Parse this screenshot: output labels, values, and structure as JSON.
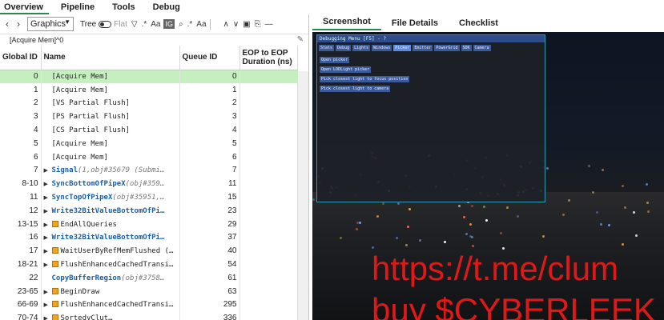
{
  "menu": [
    "Overview",
    "Pipeline",
    "Tools",
    "Debug"
  ],
  "toolbar": {
    "view_select": "Graphics",
    "tree_label": "Tree",
    "flat_label": "Flat",
    "aa_label": "Aa",
    "ig_label": "IG",
    "regex_label": ".*",
    "aa2_label": "Aa"
  },
  "breadcrumb": "[Acquire Mem]^0",
  "columns": [
    "Global ID",
    "Name",
    "Queue ID",
    "EOP to EOP Duration (ns)"
  ],
  "rows": [
    {
      "id": "0",
      "name": "[Acquire Mem]",
      "args": "",
      "queue": "0",
      "tri": false,
      "sq": false,
      "blue": false,
      "selected": true
    },
    {
      "id": "1",
      "name": "[Acquire Mem]",
      "args": "",
      "queue": "1",
      "tri": false,
      "sq": false,
      "blue": false,
      "selected": false
    },
    {
      "id": "2",
      "name": "[VS Partial Flush]",
      "args": "",
      "queue": "2",
      "tri": false,
      "sq": false,
      "blue": false,
      "selected": false
    },
    {
      "id": "3",
      "name": "[PS Partial Flush]",
      "args": "",
      "queue": "3",
      "tri": false,
      "sq": false,
      "blue": false,
      "selected": false
    },
    {
      "id": "4",
      "name": "[CS Partial Flush]",
      "args": "",
      "queue": "4",
      "tri": false,
      "sq": false,
      "blue": false,
      "selected": false
    },
    {
      "id": "5",
      "name": "[Acquire Mem]",
      "args": "",
      "queue": "5",
      "tri": false,
      "sq": false,
      "blue": false,
      "selected": false
    },
    {
      "id": "6",
      "name": "[Acquire Mem]",
      "args": "",
      "queue": "6",
      "tri": false,
      "sq": false,
      "blue": false,
      "selected": false
    },
    {
      "id": "7",
      "name": "Signal",
      "args": "(1,obj#35679 (Submi…",
      "queue": "7",
      "tri": true,
      "sq": false,
      "blue": true,
      "selected": false
    },
    {
      "id": "8-10",
      "name": "SyncBottomOfPipeX",
      "args": "(obj#359…",
      "queue": "11",
      "tri": true,
      "sq": false,
      "blue": true,
      "selected": false
    },
    {
      "id": "11",
      "name": "SyncTopOfPipeX",
      "args": "(obj#35951,…",
      "queue": "15",
      "tri": true,
      "sq": false,
      "blue": true,
      "selected": false
    },
    {
      "id": "12",
      "name": "Write32BitValueBottomOfPi…",
      "args": "",
      "queue": "23",
      "tri": true,
      "sq": false,
      "blue": true,
      "selected": false
    },
    {
      "id": "13-15",
      "name": "EndAllQueries",
      "args": "",
      "queue": "29",
      "tri": true,
      "sq": true,
      "blue": false,
      "selected": false
    },
    {
      "id": "16",
      "name": "Write32BitValueBottomOfPi…",
      "args": "",
      "queue": "37",
      "tri": true,
      "sq": false,
      "blue": true,
      "selected": false
    },
    {
      "id": "17",
      "name": "WaitUserByRefMemFlushed (…",
      "args": "",
      "queue": "40",
      "tri": true,
      "sq": true,
      "blue": false,
      "selected": false
    },
    {
      "id": "18-21",
      "name": "FlushEnhancedCachedTransi…",
      "args": "",
      "queue": "54",
      "tri": true,
      "sq": true,
      "blue": false,
      "selected": false
    },
    {
      "id": "22",
      "name": "CopyBufferRegion",
      "args": "(obj#3758…",
      "queue": "61",
      "tri": false,
      "sq": false,
      "blue": true,
      "selected": false
    },
    {
      "id": "23-65",
      "name": "BeginDraw",
      "args": "",
      "queue": "63",
      "tri": true,
      "sq": true,
      "blue": false,
      "selected": false
    },
    {
      "id": "66-69",
      "name": "FlushEnhancedCachedTransi…",
      "args": "",
      "queue": "295",
      "tri": true,
      "sq": true,
      "blue": false,
      "selected": false
    },
    {
      "id": "70-74",
      "name": "SortedyClut…",
      "args": "",
      "queue": "336",
      "tri": true,
      "sq": true,
      "blue": false,
      "selected": false
    }
  ],
  "right_tabs": [
    "Screenshot",
    "File Details",
    "Checklist"
  ],
  "screenshot": {
    "overlay_title": "Debugging Menu [F5] - ?",
    "overlay_tabs": [
      "Stats",
      "Debug",
      "Lights",
      "Windows",
      "Picker",
      "Emitter",
      "PowerGrid",
      "SDK",
      "Camera"
    ],
    "overlay_buttons": [
      "Open picker",
      "Open LODLight picker",
      "Pick closest light to focus position",
      "Pick closest light to camera"
    ],
    "watermark_line1": "https://t.me/clum",
    "watermark_line2": "buy $CYBERLEEK"
  },
  "colors": {
    "accent": "#2a8a4a",
    "selected_row": "#c6efc0",
    "blue_text": "#1a5fa8",
    "marker": "#f2a51a",
    "watermark": "#e01818"
  }
}
